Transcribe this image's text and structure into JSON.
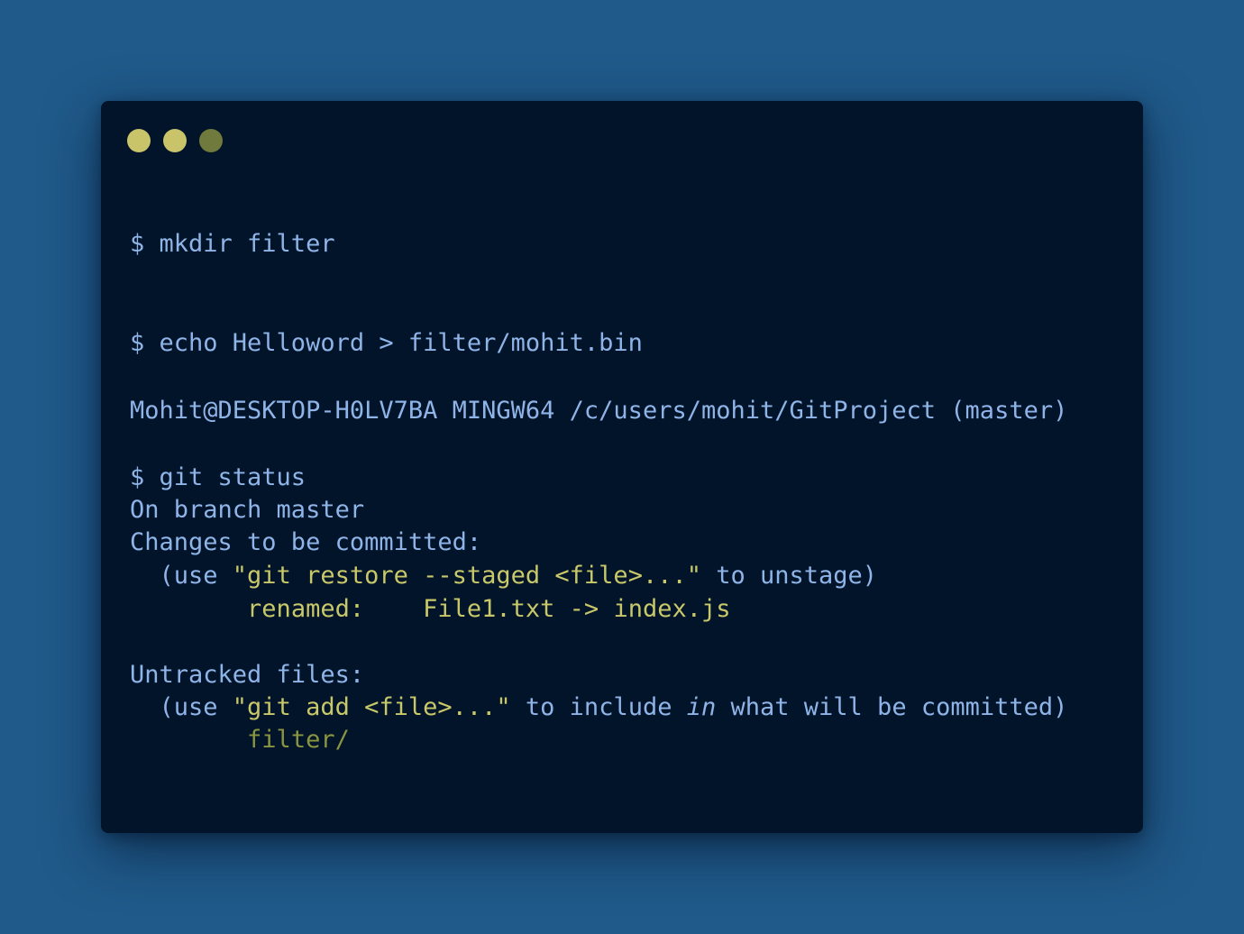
{
  "window": {
    "controls": [
      "close-dot",
      "minimize-dot",
      "maximize-dot"
    ],
    "colors": {
      "background": "#021429",
      "page_background": "#1f5a8a",
      "text": "#8fb4e8",
      "highlight": "#c8c86a",
      "untracked": "#8a9540",
      "dot_close": "#c9c46a",
      "dot_minimize": "#c9c46a",
      "dot_maximize": "#6f7a3c"
    }
  },
  "terminal": {
    "cmd_mkdir": "$ mkdir filter",
    "cmd_echo": "$ echo Helloword > filter/mohit.bin",
    "prompt": "Mohit@DESKTOP-H0LV7BA MINGW64 /c/users/mohit/GitProject (master)",
    "cmd_status": "$ git status",
    "on_branch": "On branch master",
    "changes_header": "Changes to be committed:",
    "restore_hint": {
      "open": "  (use ",
      "command": "\"git restore --staged <file>...\"",
      "close": " to unstage)"
    },
    "renamed": {
      "indent": "        ",
      "label": "renamed:",
      "gap": "    ",
      "value": "File1.txt -> index.js"
    },
    "untracked_header": "Untracked files:",
    "add_hint": {
      "open": "  (use ",
      "command": "\"git add <file>...\"",
      "mid": " to include ",
      "keyword": "in",
      "close": " what will be committed)"
    },
    "untracked_file": {
      "indent": "        ",
      "name": "filter/"
    }
  }
}
